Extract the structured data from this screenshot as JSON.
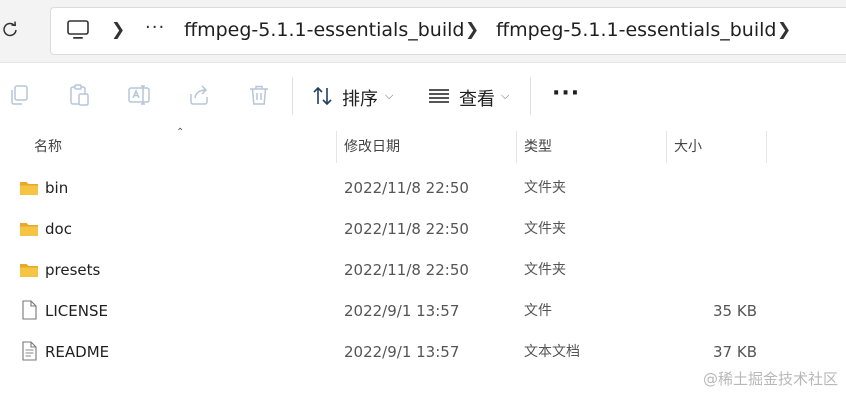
{
  "address_bar": {
    "more_glyph": "···",
    "breadcrumbs": [
      {
        "label": "ffmpeg-5.1.1-essentials_build"
      },
      {
        "label": "ffmpeg-5.1.1-essentials_build"
      }
    ]
  },
  "toolbar": {
    "sort_label": "排序",
    "view_label": "查看",
    "more_glyph": "···",
    "icons": [
      "copy-icon",
      "paste-icon",
      "rename-icon",
      "share-icon",
      "delete-icon"
    ]
  },
  "columns": {
    "name": "名称",
    "date": "修改日期",
    "type": "类型",
    "size": "大小"
  },
  "files": [
    {
      "name": "bin",
      "date": "2022/11/8 22:50",
      "type": "文件夹",
      "size": "",
      "kind": "folder"
    },
    {
      "name": "doc",
      "date": "2022/11/8 22:50",
      "type": "文件夹",
      "size": "",
      "kind": "folder"
    },
    {
      "name": "presets",
      "date": "2022/11/8 22:50",
      "type": "文件夹",
      "size": "",
      "kind": "folder"
    },
    {
      "name": "LICENSE",
      "date": "2022/9/1 13:57",
      "type": "文件",
      "size": "35 KB",
      "kind": "file"
    },
    {
      "name": "README",
      "date": "2022/9/1 13:57",
      "type": "文本文档",
      "size": "37 KB",
      "kind": "text"
    }
  ],
  "watermark": "@稀土掘金技术社区",
  "colors": {
    "folder": "#f5c443",
    "folder_back": "#e8a92b"
  }
}
